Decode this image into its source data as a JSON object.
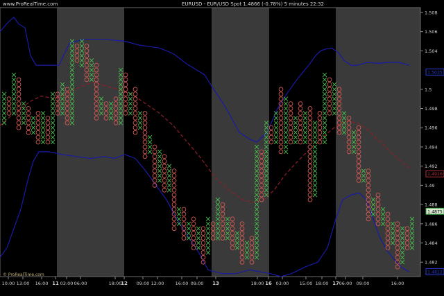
{
  "header": {
    "site": "www.ProRealTime.com",
    "title": "EURUSD - EUR/USD Spot   1.4866 (-0.78%)   5 minutes  22:32"
  },
  "watermark": "© ProRealTime.com",
  "colors": {
    "background": "#000000",
    "session_band": "#3a3a3a",
    "x_mark": "#49c24f",
    "o_mark": "#d65b55",
    "bollinger": "#1a1aa8",
    "moving_average": "#8e1e2a",
    "text": "#d0d0d0"
  },
  "chart_data": {
    "type": "point-and-figure",
    "ylim": [
      1.4805,
      1.5085
    ],
    "xlim": [
      0,
      606
    ],
    "y_ticks": [
      {
        "value": 1.508,
        "label": "1.508"
      },
      {
        "value": 1.506,
        "label": "1.506"
      },
      {
        "value": 1.504,
        "label": "1.504"
      },
      {
        "value": 1.5,
        "label": "1.5"
      },
      {
        "value": 1.498,
        "label": "1.498"
      },
      {
        "value": 1.496,
        "label": "1.496"
      },
      {
        "value": 1.494,
        "label": "1.494"
      },
      {
        "value": 1.492,
        "label": "1.492"
      },
      {
        "value": 1.49,
        "label": "1.49"
      },
      {
        "value": 1.488,
        "label": "1.488"
      },
      {
        "value": 1.486,
        "label": "1.486"
      },
      {
        "value": 1.484,
        "label": "1.484"
      },
      {
        "value": 1.482,
        "label": "1.482"
      }
    ],
    "x_ticks": [
      {
        "x": 12,
        "label": "10:00"
      },
      {
        "x": 33,
        "label": "13:00"
      },
      {
        "x": 60,
        "label": "16:00"
      },
      {
        "x": 80,
        "label": "11",
        "bold": true
      },
      {
        "x": 96,
        "label": "03:00"
      },
      {
        "x": 116,
        "label": "06:00"
      },
      {
        "x": 166,
        "label": "18:00"
      },
      {
        "x": 179,
        "label": "12",
        "bold": true
      },
      {
        "x": 206,
        "label": "09:00"
      },
      {
        "x": 227,
        "label": "12:00"
      },
      {
        "x": 262,
        "label": "16:00"
      },
      {
        "x": 284,
        "label": "09:00"
      },
      {
        "x": 311,
        "label": "13",
        "bold": true
      },
      {
        "x": 371,
        "label": "18:00"
      },
      {
        "x": 387,
        "label": "16",
        "bold": true
      },
      {
        "x": 407,
        "label": "03:00"
      },
      {
        "x": 441,
        "label": "15:00"
      },
      {
        "x": 464,
        "label": "18:00"
      },
      {
        "x": 484,
        "label": "17",
        "bold": true
      },
      {
        "x": 498,
        "label": "06:00"
      },
      {
        "x": 523,
        "label": "09:00"
      },
      {
        "x": 573,
        "label": "16:00"
      }
    ],
    "session_bands": [
      [
        82,
        179
      ],
      [
        305,
        388
      ],
      [
        484,
        606
      ]
    ],
    "pnf_box": 0.0005,
    "columns": [
      {
        "x": 6,
        "type": "X",
        "low": 1.4965,
        "high": 1.4995
      },
      {
        "x": 13,
        "type": "O",
        "low": 1.4975,
        "high": 1.499
      },
      {
        "x": 20,
        "type": "X",
        "low": 1.4975,
        "high": 1.5015
      },
      {
        "x": 27,
        "type": "O",
        "low": 1.496,
        "high": 1.501
      },
      {
        "x": 34,
        "type": "X",
        "low": 1.4965,
        "high": 1.4985
      },
      {
        "x": 41,
        "type": "O",
        "low": 1.4955,
        "high": 1.498
      },
      {
        "x": 48,
        "type": "X",
        "low": 1.4955,
        "high": 1.497
      },
      {
        "x": 55,
        "type": "O",
        "low": 1.4945,
        "high": 1.4975
      },
      {
        "x": 62,
        "type": "X",
        "low": 1.4945,
        "high": 1.4975
      },
      {
        "x": 69,
        "type": "O",
        "low": 1.4945,
        "high": 1.497
      },
      {
        "x": 76,
        "type": "X",
        "low": 1.4945,
        "high": 1.4995
      },
      {
        "x": 83,
        "type": "O",
        "low": 1.4975,
        "high": 1.4995
      },
      {
        "x": 90,
        "type": "X",
        "low": 1.4975,
        "high": 1.5005
      },
      {
        "x": 97,
        "type": "O",
        "low": 1.4965,
        "high": 1.5
      },
      {
        "x": 104,
        "type": "X",
        "low": 1.4965,
        "high": 1.505
      },
      {
        "x": 111,
        "type": "O",
        "low": 1.503,
        "high": 1.5045
      },
      {
        "x": 118,
        "type": "X",
        "low": 1.5025,
        "high": 1.505
      },
      {
        "x": 125,
        "type": "O",
        "low": 1.501,
        "high": 1.5045
      },
      {
        "x": 132,
        "type": "X",
        "low": 1.501,
        "high": 1.503
      },
      {
        "x": 139,
        "type": "O",
        "low": 1.497,
        "high": 1.5025
      },
      {
        "x": 146,
        "type": "X",
        "low": 1.4975,
        "high": 1.499
      },
      {
        "x": 153,
        "type": "O",
        "low": 1.497,
        "high": 1.4985
      },
      {
        "x": 160,
        "type": "X",
        "low": 1.497,
        "high": 1.4985
      },
      {
        "x": 167,
        "type": "O",
        "low": 1.4965,
        "high": 1.499
      },
      {
        "x": 174,
        "type": "X",
        "low": 1.4965,
        "high": 1.502
      },
      {
        "x": 181,
        "type": "O",
        "low": 1.4975,
        "high": 1.5015
      },
      {
        "x": 188,
        "type": "X",
        "low": 1.4975,
        "high": 1.4995
      },
      {
        "x": 195,
        "type": "O",
        "low": 1.4955,
        "high": 1.5
      },
      {
        "x": 202,
        "type": "X",
        "low": 1.496,
        "high": 1.4975
      },
      {
        "x": 209,
        "type": "O",
        "low": 1.493,
        "high": 1.4975
      },
      {
        "x": 216,
        "type": "X",
        "low": 1.4935,
        "high": 1.495
      },
      {
        "x": 223,
        "type": "O",
        "low": 1.49,
        "high": 1.494
      },
      {
        "x": 230,
        "type": "X",
        "low": 1.4905,
        "high": 1.4935
      },
      {
        "x": 237,
        "type": "O",
        "low": 1.4895,
        "high": 1.493
      },
      {
        "x": 244,
        "type": "X",
        "low": 1.4895,
        "high": 1.492
      },
      {
        "x": 251,
        "type": "O",
        "low": 1.4855,
        "high": 1.4915
      },
      {
        "x": 258,
        "type": "X",
        "low": 1.486,
        "high": 1.4875
      },
      {
        "x": 265,
        "type": "O",
        "low": 1.4845,
        "high": 1.4875
      },
      {
        "x": 272,
        "type": "X",
        "low": 1.4845,
        "high": 1.486
      },
      {
        "x": 279,
        "type": "O",
        "low": 1.4835,
        "high": 1.4865
      },
      {
        "x": 286,
        "type": "X",
        "low": 1.4835,
        "high": 1.4855
      },
      {
        "x": 293,
        "type": "O",
        "low": 1.482,
        "high": 1.4855
      },
      {
        "x": 300,
        "type": "X",
        "low": 1.483,
        "high": 1.4865
      },
      {
        "x": 307,
        "type": "O",
        "low": 1.4845,
        "high": 1.486
      },
      {
        "x": 314,
        "type": "X",
        "low": 1.4845,
        "high": 1.4885
      },
      {
        "x": 321,
        "type": "O",
        "low": 1.4845,
        "high": 1.488
      },
      {
        "x": 328,
        "type": "X",
        "low": 1.4845,
        "high": 1.4865
      },
      {
        "x": 335,
        "type": "O",
        "low": 1.4835,
        "high": 1.4865
      },
      {
        "x": 342,
        "type": "X",
        "low": 1.4835,
        "high": 1.485
      },
      {
        "x": 349,
        "type": "O",
        "low": 1.482,
        "high": 1.486
      },
      {
        "x": 356,
        "type": "X",
        "low": 1.4825,
        "high": 1.484
      },
      {
        "x": 363,
        "type": "O",
        "low": 1.482,
        "high": 1.4845
      },
      {
        "x": 370,
        "type": "X",
        "low": 1.4825,
        "high": 1.494
      },
      {
        "x": 377,
        "type": "O",
        "low": 1.4885,
        "high": 1.4935
      },
      {
        "x": 384,
        "type": "X",
        "low": 1.489,
        "high": 1.4965
      },
      {
        "x": 391,
        "type": "O",
        "low": 1.4945,
        "high": 1.496
      },
      {
        "x": 398,
        "type": "X",
        "low": 1.4945,
        "high": 1.4975
      },
      {
        "x": 405,
        "type": "O",
        "low": 1.4935,
        "high": 1.5
      },
      {
        "x": 412,
        "type": "X",
        "low": 1.4935,
        "high": 1.499
      },
      {
        "x": 419,
        "type": "O",
        "low": 1.4945,
        "high": 1.4985
      },
      {
        "x": 426,
        "type": "X",
        "low": 1.4945,
        "high": 1.497
      },
      {
        "x": 433,
        "type": "O",
        "low": 1.4945,
        "high": 1.4985
      },
      {
        "x": 440,
        "type": "X",
        "low": 1.4945,
        "high": 1.4975
      },
      {
        "x": 447,
        "type": "O",
        "low": 1.4885,
        "high": 1.498
      },
      {
        "x": 454,
        "type": "X",
        "low": 1.489,
        "high": 1.4965
      },
      {
        "x": 461,
        "type": "O",
        "low": 1.4945,
        "high": 1.4975
      },
      {
        "x": 468,
        "type": "X",
        "low": 1.4945,
        "high": 1.5015
      },
      {
        "x": 475,
        "type": "O",
        "low": 1.4975,
        "high": 1.501
      },
      {
        "x": 482,
        "type": "X",
        "low": 1.4975,
        "high": 1.5005
      },
      {
        "x": 489,
        "type": "O",
        "low": 1.4955,
        "high": 1.5
      },
      {
        "x": 496,
        "type": "X",
        "low": 1.4955,
        "high": 1.4975
      },
      {
        "x": 503,
        "type": "O",
        "low": 1.4935,
        "high": 1.497
      },
      {
        "x": 510,
        "type": "X",
        "low": 1.4935,
        "high": 1.4955
      },
      {
        "x": 517,
        "type": "O",
        "low": 1.4905,
        "high": 1.496
      },
      {
        "x": 524,
        "type": "X",
        "low": 1.4905,
        "high": 1.4915
      },
      {
        "x": 531,
        "type": "O",
        "low": 1.4865,
        "high": 1.4915
      },
      {
        "x": 538,
        "type": "X",
        "low": 1.487,
        "high": 1.4885
      },
      {
        "x": 545,
        "type": "O",
        "low": 1.486,
        "high": 1.489
      },
      {
        "x": 552,
        "type": "X",
        "low": 1.486,
        "high": 1.4875
      },
      {
        "x": 559,
        "type": "O",
        "low": 1.4835,
        "high": 1.487
      },
      {
        "x": 566,
        "type": "X",
        "low": 1.484,
        "high": 1.486
      },
      {
        "x": 573,
        "type": "O",
        "low": 1.4815,
        "high": 1.486
      },
      {
        "x": 580,
        "type": "X",
        "low": 1.482,
        "high": 1.4855
      },
      {
        "x": 587,
        "type": "O",
        "low": 1.4835,
        "high": 1.4855
      },
      {
        "x": 594,
        "type": "X",
        "low": 1.4835,
        "high": 1.4865
      }
    ],
    "upper_band": [
      [
        0,
        1.506
      ],
      [
        12,
        1.507
      ],
      [
        20,
        1.5075
      ],
      [
        27,
        1.5068
      ],
      [
        36,
        1.5064
      ],
      [
        44,
        1.5035
      ],
      [
        52,
        1.5025
      ],
      [
        66,
        1.5025
      ],
      [
        85,
        1.5025
      ],
      [
        100,
        1.5048
      ],
      [
        120,
        1.5052
      ],
      [
        150,
        1.5052
      ],
      [
        180,
        1.505
      ],
      [
        200,
        1.5046
      ],
      [
        230,
        1.5043
      ],
      [
        250,
        1.5037
      ],
      [
        270,
        1.5026
      ],
      [
        295,
        1.5015
      ],
      [
        308,
        1.5
      ],
      [
        322,
        1.4985
      ],
      [
        330,
        1.4975
      ],
      [
        345,
        1.4955
      ],
      [
        360,
        1.4948
      ],
      [
        370,
        1.4945
      ],
      [
        385,
        1.4955
      ],
      [
        400,
        1.498
      ],
      [
        415,
        1.4997
      ],
      [
        430,
        1.5012
      ],
      [
        445,
        1.5025
      ],
      [
        455,
        1.5035
      ],
      [
        462,
        1.504
      ],
      [
        470,
        1.5042
      ],
      [
        478,
        1.5043
      ],
      [
        488,
        1.5038
      ],
      [
        496,
        1.503
      ],
      [
        506,
        1.5025
      ],
      [
        515,
        1.5025
      ],
      [
        530,
        1.5028
      ],
      [
        545,
        1.5027
      ],
      [
        560,
        1.5028
      ],
      [
        575,
        1.5028
      ],
      [
        590,
        1.5025
      ]
    ],
    "lower_band": [
      [
        0,
        1.4825
      ],
      [
        10,
        1.4835
      ],
      [
        20,
        1.4855
      ],
      [
        30,
        1.4875
      ],
      [
        40,
        1.4905
      ],
      [
        48,
        1.4925
      ],
      [
        56,
        1.4935
      ],
      [
        70,
        1.4935
      ],
      [
        90,
        1.4932
      ],
      [
        110,
        1.493
      ],
      [
        130,
        1.4928
      ],
      [
        150,
        1.493
      ],
      [
        165,
        1.4928
      ],
      [
        180,
        1.4932
      ],
      [
        195,
        1.4928
      ],
      [
        210,
        1.4915
      ],
      [
        225,
        1.49
      ],
      [
        240,
        1.4885
      ],
      [
        255,
        1.4865
      ],
      [
        270,
        1.4848
      ],
      [
        285,
        1.4832
      ],
      [
        300,
        1.4812
      ],
      [
        320,
        1.4808
      ],
      [
        340,
        1.4808
      ],
      [
        360,
        1.4812
      ],
      [
        375,
        1.481
      ],
      [
        390,
        1.4808
      ],
      [
        405,
        1.4805
      ],
      [
        420,
        1.4808
      ],
      [
        440,
        1.4815
      ],
      [
        458,
        1.482
      ],
      [
        472,
        1.4835
      ],
      [
        484,
        1.4865
      ],
      [
        494,
        1.4885
      ],
      [
        506,
        1.489
      ],
      [
        518,
        1.4892
      ],
      [
        528,
        1.4885
      ],
      [
        538,
        1.4865
      ],
      [
        548,
        1.4845
      ],
      [
        558,
        1.4832
      ],
      [
        568,
        1.4823
      ],
      [
        578,
        1.4815
      ],
      [
        590,
        1.481
      ]
    ],
    "moving_average": [
      [
        0,
        1.4962
      ],
      [
        15,
        1.4972
      ],
      [
        30,
        1.498
      ],
      [
        45,
        1.4988
      ],
      [
        60,
        1.4993
      ],
      [
        80,
        1.499
      ],
      [
        100,
        1.4997
      ],
      [
        120,
        1.5004
      ],
      [
        135,
        1.5007
      ],
      [
        150,
        1.5004
      ],
      [
        170,
        1.5
      ],
      [
        190,
        1.4995
      ],
      [
        210,
        1.4985
      ],
      [
        230,
        1.4975
      ],
      [
        250,
        1.4962
      ],
      [
        270,
        1.4945
      ],
      [
        290,
        1.4928
      ],
      [
        310,
        1.4908
      ],
      [
        330,
        1.4895
      ],
      [
        350,
        1.4885
      ],
      [
        365,
        1.4882
      ],
      [
        380,
        1.4885
      ],
      [
        395,
        1.4895
      ],
      [
        410,
        1.491
      ],
      [
        425,
        1.4922
      ],
      [
        440,
        1.4933
      ],
      [
        455,
        1.4943
      ],
      [
        470,
        1.4953
      ],
      [
        485,
        1.4962
      ],
      [
        500,
        1.4967
      ],
      [
        515,
        1.4965
      ],
      [
        530,
        1.4958
      ],
      [
        545,
        1.4947
      ],
      [
        560,
        1.4937
      ],
      [
        575,
        1.4927
      ],
      [
        590,
        1.4918
      ]
    ],
    "price_markers": [
      {
        "value": 1.5018,
        "label": "1.5025",
        "color": "#2a3bd6",
        "text": "#2a3bd6",
        "fill": "#000000"
      },
      {
        "value": 1.4912,
        "label": "1.4916",
        "color": "#b0303a",
        "text": "#b0303a",
        "fill": "#000000"
      },
      {
        "value": 1.4873,
        "label": "1.4875",
        "color": "#2f9e37",
        "text": "#000000",
        "fill": "#d9ead0"
      },
      {
        "value": 1.481,
        "label": "1.4812",
        "color": "#2a3bd6",
        "text": "#2a3bd6",
        "fill": "#000000"
      }
    ]
  }
}
